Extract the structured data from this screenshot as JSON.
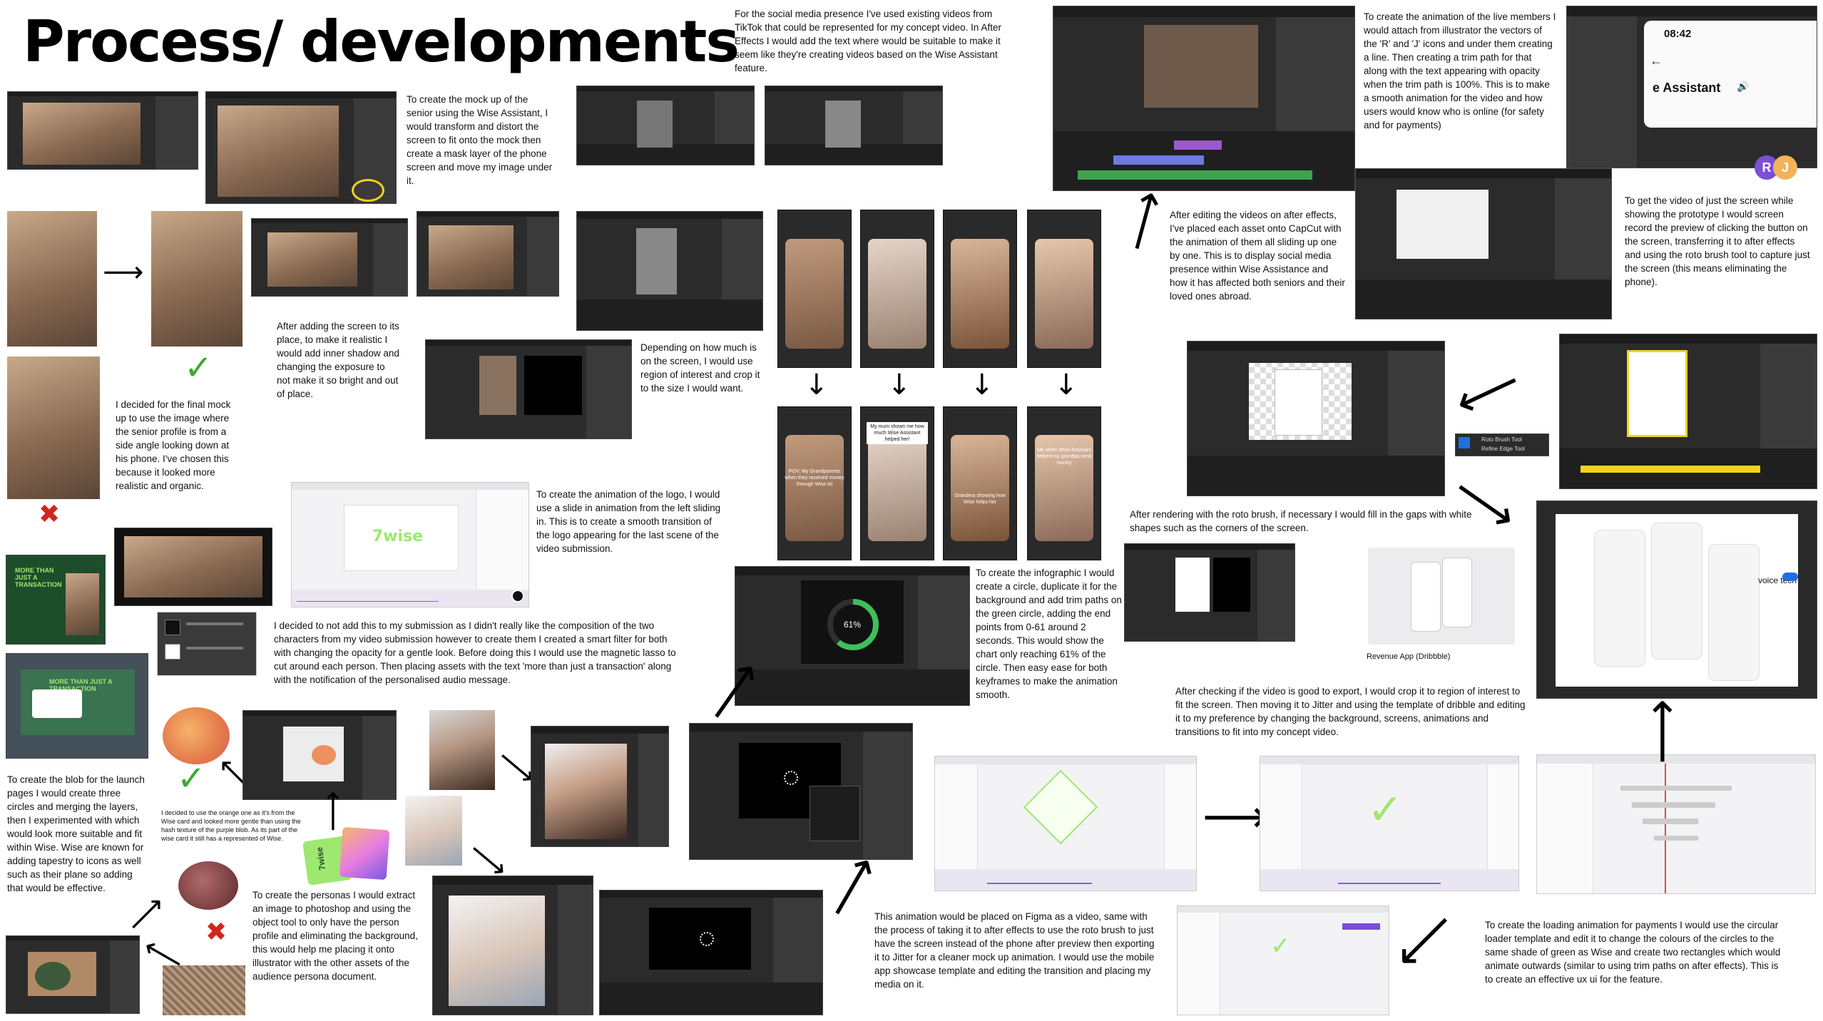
{
  "title": "Process/ developments",
  "notes": {
    "mockup": "To create the mock up of the senior using the Wise Assistant, I would transform and distort the screen to fit onto the mock then create a mask layer of the phone screen and move my image under it.",
    "social": "For the social media presence I've used existing videos from TikTok that could be represented for my concept video. In After Effects I would add the text where would be suitable to make it seem like they're creating videos based on the Wise Assistant feature.",
    "live_members": "To create the animation of the live members I would attach from illustrator the vectors of the 'R' and 'J' icons and under them creating a line. Then creating a trim path for that along with the text appearing with opacity when the trim path is 100%. This is to make a smooth animation for the video and how users would know who is online (for safety and for payments)",
    "adding_screen": "After adding the screen to its place, to make it realistic I would add inner shadow and changing the exposure to not make it so bright and out of place.",
    "region": "Depending on how much is on the screen, I would use region of interest and crop it to the size I would want.",
    "capcut": "After editing the videos on after effects, I've placed each asset onto CapCut with the animation of them all sliding up one by one. This is to display social media presence within Wise Assistance and how it has affected both seniors and their loved ones abroad.",
    "roto_prototype": "To get the video of just the screen while showing the prototype I would screen record the preview of clicking the button on the screen, transferring it to after effects and using the roto brush tool to capture just the screen (this means eliminating the phone).",
    "final_mock": "I decided for the final mock up to use the image where the senior profile is from a side angle looking down at his phone. I've chosen this because it looked more realistic and organic.",
    "logo": "To create the animation of the logo, I would use a slide in animation from the left sliding in. This is to create a smooth transition of the logo appearing for the last scene of the video submission.",
    "roto_gaps": "After rendering with the roto brush, if necessary I would fill in the gaps with white shapes such as the corners of the screen.",
    "composition": "I decided to not add this to my submission as I didn't really like the composition of the two characters from my video submission however to create them I created a smart filter for both with changing the opacity for a gentle look. Before doing this I would use the magnetic lasso to cut around each person. Then placing assets with the text 'more than just a transaction' along with the notification of the personalised audio message.",
    "infographic": "To create the infographic I would create a circle, duplicate it for the background and add trim paths on the green circle, adding the end points from 0-61 around 2 seconds. This would show the chart only reaching 61% of the circle. Then easy ease for both keyframes to make the animation smooth.",
    "dribbble": "After checking if the video is good to export, I would crop it to region of interest to fit the screen. Then moving it to Jitter and using the template of dribble and editing it to my preference by changing the background, screens, animations and transitions to fit into my concept video.",
    "blob": "To create the blob for the launch pages I would create three circles and merging the layers, then I experimented with which would look more suitable and fit within Wise. Wise are known for adding tapestry to icons as well such as their plane so adding that would be effective.",
    "orange": "I decided to use the orange one as it's from the Wise card and looked more gentle than using the hash texture of the purple blob. As its part of the wise card it still has a represented of Wise.",
    "personas": "To create the personas I would extract an image to photoshop and using the object tool to only have the person profile and eliminating the background, this would help me placing it onto illustrator with the other assets of the audience persona document.",
    "figma": "This animation would be placed on Figma as a video, same with the process of taking it to after effects to use the roto brush to just have the screen instead of the phone after preview then exporting it to Jitter for a cleaner mock up animation. I would use the mobile app showcase template and editing the transition and placing my media on it.",
    "loading": "To create the loading animation for payments I would use the circular loader template and edit it to change the colours of the circles to the same shade of green as Wise and create two rectangles which would animate outwards (similar to using trim paths on after effects). This is to create an effective ux ui for the feature."
  },
  "ui_text": {
    "phone_time": "08:42",
    "assistant_label": "e Assistant",
    "avatar_r": "R",
    "avatar_j": "J",
    "progress_value": "61%",
    "wise_logo": "7wise",
    "voice_tech": "voice tech",
    "revenue_app": "Revenue App (Dribbble)",
    "more_than_just_1": "MORE THAN JUST A TRANSACTION",
    "more_than_just_2": "MORE THAN JUST A TRANSACTION",
    "roto_brush_tool": "Roto Brush Tool",
    "refine_edge_tool": "Refine Edge Tool",
    "card_wise": "7wise",
    "tt_captions": [
      "POV: My Grandparents when they received money through Wise lol",
      "My mum shown me how much Wise Assistant helped her!",
      "Grandma showing how Wise helps her",
      "Me when Wise Assistant helped my grandpa send money"
    ]
  },
  "progress": {
    "fraction": 0.61
  },
  "colors": {
    "wise_green": "#9fe870",
    "check": "#3aa935",
    "cross": "#d0261d",
    "avatar_r": "#7b4fd6",
    "avatar_j": "#f1b35a"
  }
}
